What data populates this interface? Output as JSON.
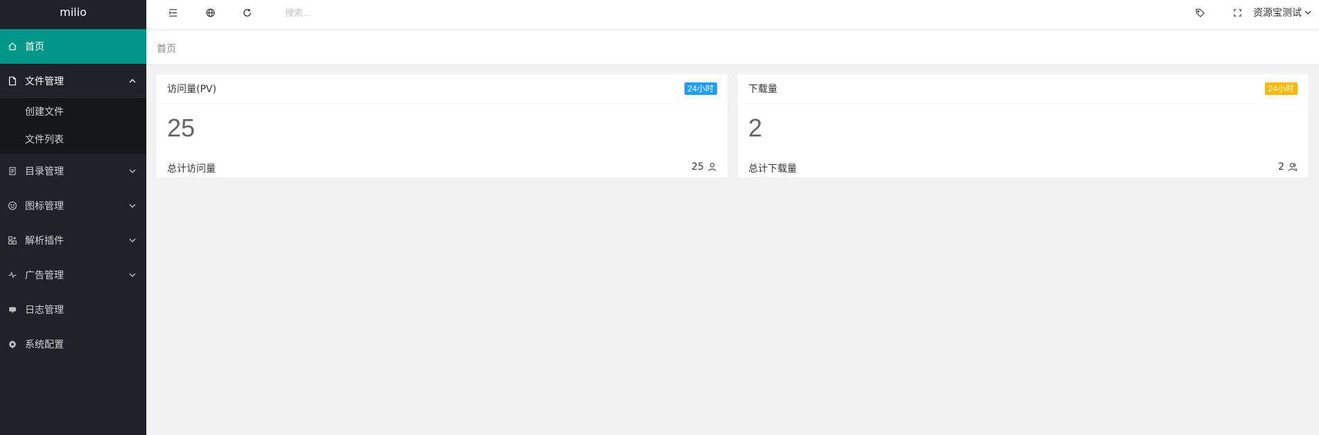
{
  "app": {
    "logo": "milio"
  },
  "sidebar": {
    "items": [
      {
        "label": "首页",
        "icon": "home-icon",
        "active": true
      },
      {
        "label": "文件管理",
        "icon": "file-icon",
        "open": true,
        "children": [
          {
            "label": "创建文件"
          },
          {
            "label": "文件列表"
          }
        ]
      },
      {
        "label": "目录管理",
        "icon": "catalog-icon"
      },
      {
        "label": "图标管理",
        "icon": "smile-icon"
      },
      {
        "label": "解析插件",
        "icon": "app-grid-icon"
      },
      {
        "label": "广告管理",
        "icon": "pulse-icon"
      },
      {
        "label": "日志管理",
        "icon": "monitor-icon"
      },
      {
        "label": "系统配置",
        "icon": "gear-icon"
      }
    ]
  },
  "header": {
    "search_placeholder": "搜索...",
    "user_name": "资源宝测试",
    "icons": [
      "menu-toggle-icon",
      "globe-icon",
      "refresh-icon",
      "tag-icon",
      "fullscreen-icon"
    ]
  },
  "breadcrumb": {
    "current": "首页"
  },
  "cards": [
    {
      "title": "访问量(PV)",
      "badge": "24小时",
      "badge_color": "#1e9fff",
      "value": "25",
      "subtitle": "总计访问量",
      "total": "25"
    },
    {
      "title": "下载量",
      "badge": "24小时",
      "badge_color": "#ffb800",
      "value": "2",
      "subtitle": "总计下载量",
      "total": "2"
    }
  ],
  "colors": {
    "sidebar_bg": "#20222a",
    "active": "#009688",
    "body_bg": "#f2f2f2"
  }
}
